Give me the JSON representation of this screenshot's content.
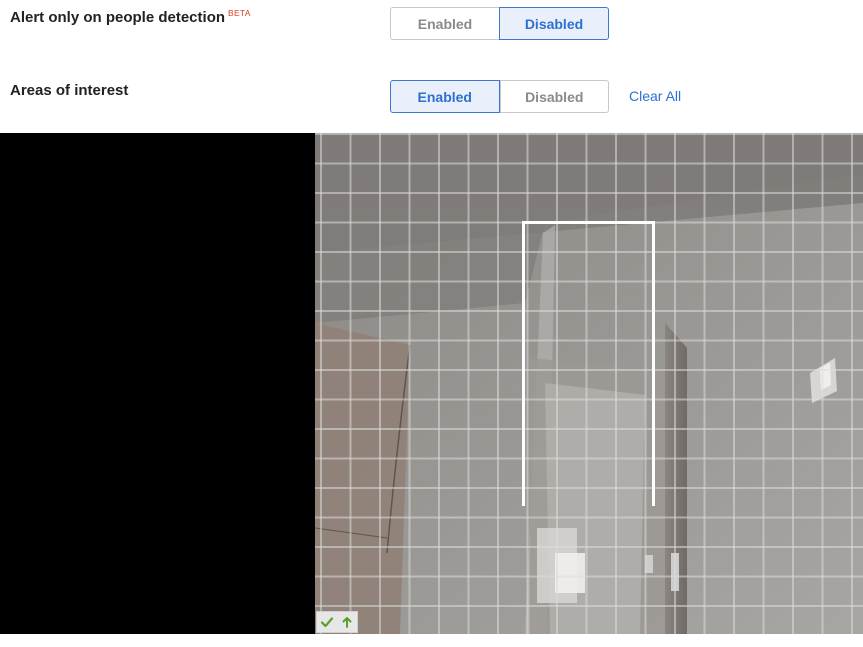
{
  "settings": {
    "people_detection": {
      "label": "Alert only on people detection",
      "badge": "BETA",
      "options": [
        "Enabled",
        "Disabled"
      ],
      "selected": "Disabled"
    },
    "areas_of_interest": {
      "label": "Areas of interest",
      "options": [
        "Enabled",
        "Disabled"
      ],
      "selected": "Enabled",
      "clear_label": "Clear All"
    }
  },
  "viewer": {
    "tools": [
      "check-icon",
      "upload-arrow-icon"
    ]
  },
  "colors": {
    "accent": "#2f6fd0",
    "active_bg": "#e9f0fb",
    "beta": "#d9401e",
    "tool_green": "#5aa02c"
  }
}
